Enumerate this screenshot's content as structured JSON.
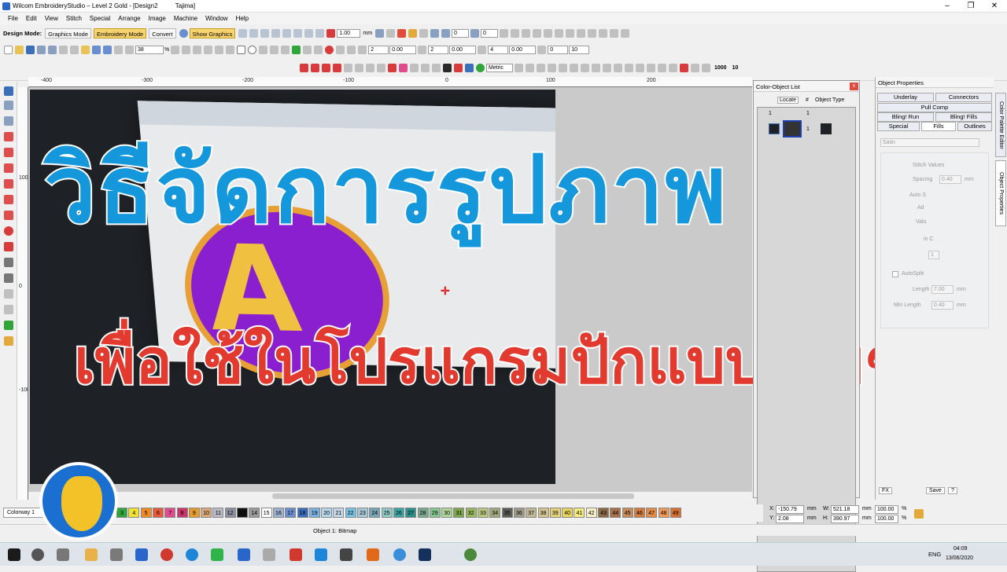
{
  "window": {
    "title": "Wilcom EmbroideryStudio – Level 2 Gold - [Design2",
    "title_machine": "Tajima]",
    "controls": [
      "–",
      "❐",
      "✕"
    ]
  },
  "menu": [
    "File",
    "Edit",
    "View",
    "Stitch",
    "Special",
    "Arrange",
    "Image",
    "Machine",
    "Window",
    "Help"
  ],
  "toolbar1": {
    "design_mode_label": "Design Mode:",
    "graphics_mode": "Graphics Mode",
    "embroidery_mode": "Embroidery Mode",
    "convert": "Convert",
    "show_graphics": "Show Graphics",
    "scale_value": "1.00",
    "unit_mm": "mm",
    "angle_value": "0",
    "angle_value2": "0"
  },
  "toolbar2": {
    "zoom_value": "38",
    "zoom_unit": "%",
    "field_a": "2",
    "field_b": "0.00",
    "field_c": "2",
    "field_d": "0.00",
    "field_e": "4",
    "field_f": "0.00",
    "field_g": "0",
    "field_h": "10"
  },
  "toolbar3": {
    "units": "Metric",
    "value_1000": "1000",
    "value_10": "10"
  },
  "ruler_h": [
    "-400",
    "-300",
    "-200",
    "-100",
    "0",
    "100",
    "200"
  ],
  "ruler_v": [
    "100",
    "0",
    "-100"
  ],
  "overlay": {
    "title_thai": "วิธีจัดการรูปภาพ",
    "subtitle_thai": "เพื่อใช้ในโปรแกรมปักแบบง่ายๆ"
  },
  "color_object_list": {
    "title": "Color-Object List",
    "locate": "Locate",
    "col_num": "#",
    "col_type": "Object Type",
    "row_a": "1",
    "row_b": "1",
    "row_c": "1"
  },
  "object_properties": {
    "title": "Object Properties",
    "tabs_row1": [
      "Underlay",
      "Connectors"
    ],
    "tab_pull": "Pull Comp",
    "tabs_row2": [
      "Bling! Run",
      "Bling! Fills"
    ],
    "tabs_row3": [
      "Special",
      "Fills",
      "Outlines"
    ],
    "fill_type": "Satin",
    "stitch_values": "Stitch Values",
    "spacing_label": "Spacing",
    "spacing_value": "0.40",
    "auto_label": "Auto S",
    "adj_label": "Ad",
    "value_label": "Valu",
    "in_label": "in C",
    "one_value": "1",
    "autosplit": "AutoSplit",
    "length_label": "Length",
    "length_value": "7.00",
    "min_length_label": "Min Length",
    "min_length_value": "0.40",
    "mm": "mm",
    "fx": "FX",
    "save": "Save",
    "help": "?"
  },
  "side_tabs": [
    "Color Palette Editor",
    "Object Properties"
  ],
  "colorway": "Colorway 1",
  "swatches": [
    {
      "n": "3",
      "c": "#2fa53a"
    },
    {
      "n": "4",
      "c": "#f0e230"
    },
    {
      "n": "5",
      "c": "#f08a24"
    },
    {
      "n": "6",
      "c": "#e85a3a"
    },
    {
      "n": "7",
      "c": "#e04d8c"
    },
    {
      "n": "8",
      "c": "#c8356b"
    },
    {
      "n": "9",
      "c": "#e59a2a"
    },
    {
      "n": "10",
      "c": "#d9a97a"
    },
    {
      "n": "11",
      "c": "#b9b9c6"
    },
    {
      "n": "12",
      "c": "#8e8f9e"
    },
    {
      "n": "13",
      "c": "#111111"
    },
    {
      "n": "14",
      "c": "#9a9a9a"
    },
    {
      "n": "15",
      "c": "#ffffff"
    },
    {
      "n": "16",
      "c": "#9db0cc"
    },
    {
      "n": "17",
      "c": "#6a8fd0"
    },
    {
      "n": "18",
      "c": "#3a6cc0"
    },
    {
      "n": "19",
      "c": "#7ab2e0"
    },
    {
      "n": "20",
      "c": "#b6d6ee"
    },
    {
      "n": "21",
      "c": "#c4d7e9"
    },
    {
      "n": "22",
      "c": "#7ac2e2"
    },
    {
      "n": "23",
      "c": "#a7c8d6"
    },
    {
      "n": "24",
      "c": "#7aa5b8"
    },
    {
      "n": "25",
      "c": "#8ec8c4"
    },
    {
      "n": "26",
      "c": "#3aa7a3"
    },
    {
      "n": "27",
      "c": "#2c8f8a"
    },
    {
      "n": "28",
      "c": "#79a88f"
    },
    {
      "n": "29",
      "c": "#86c68f"
    },
    {
      "n": "30",
      "c": "#b0d69a"
    },
    {
      "n": "31",
      "c": "#7ea84c"
    },
    {
      "n": "32",
      "c": "#99b860"
    },
    {
      "n": "33",
      "c": "#b8c680"
    },
    {
      "n": "34",
      "c": "#a3a67a"
    },
    {
      "n": "35",
      "c": "#5a5c58"
    },
    {
      "n": "36",
      "c": "#9e9a8a"
    },
    {
      "n": "37",
      "c": "#bfb796"
    },
    {
      "n": "38",
      "c": "#d4c58e"
    },
    {
      "n": "39",
      "c": "#e4d17a"
    },
    {
      "n": "40",
      "c": "#e9d55a"
    },
    {
      "n": "41",
      "c": "#f2ea7c"
    },
    {
      "n": "42",
      "c": "#f6f0c8"
    },
    {
      "n": "43",
      "c": "#8a6a45"
    },
    {
      "n": "44",
      "c": "#a5704a"
    },
    {
      "n": "45",
      "c": "#c98a5a"
    },
    {
      "n": "46",
      "c": "#d47b3a"
    },
    {
      "n": "47",
      "c": "#e58b4a"
    },
    {
      "n": "48",
      "c": "#f09a5a"
    },
    {
      "n": "49",
      "c": "#d8702f"
    }
  ],
  "coords": {
    "x_label": "X:",
    "x_value": "-150.79",
    "y_label": "Y:",
    "y_value": "2.08",
    "w_label": "W:",
    "w_value": "521.18",
    "h_label": "H:",
    "h_value": "390.97",
    "wp": "100.00",
    "hp": "100.00",
    "mm": "mm",
    "pct": "%"
  },
  "status": {
    "object": "Object 1: Bitmap"
  },
  "taskbar": {
    "lang": "ENG",
    "time": "04:09",
    "date": "13/06/2020"
  }
}
